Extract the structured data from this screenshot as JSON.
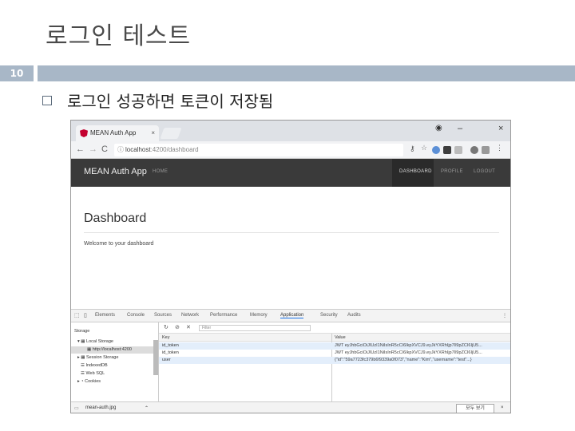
{
  "slide": {
    "title": "로그인 테스트",
    "page_number": "10",
    "bullet": "로그인 성공하면 토큰이 저장됨"
  },
  "browser": {
    "tab_title": "MEAN Auth App",
    "tab_close": "×",
    "url_host": "localhost",
    "url_rest": ":4200/dashboard",
    "back": "←",
    "forward": "→",
    "reload": "C",
    "info_icon": "ⓘ",
    "minimize": "–",
    "close": "×"
  },
  "app": {
    "brand": "MEAN Auth App",
    "nav_home": "HOME",
    "nav_dashboard": "DASHBOARD",
    "nav_profile": "PROFILE",
    "nav_logout": "LOGOUT",
    "dashboard_title": "Dashboard",
    "welcome": "Welcome to your dashboard"
  },
  "devtools": {
    "tabs": [
      "Elements",
      "Console",
      "Sources",
      "Network",
      "Performance",
      "Memory",
      "Application",
      "Security",
      "Audits"
    ],
    "active_tab": "Application",
    "storage_label": "Storage",
    "local_storage": "Local Storage",
    "local_origin": "http://localhost:4200",
    "session_storage": "Session Storage",
    "indexeddb": "IndexedDB",
    "websql": "Web SQL",
    "cookies": "Cookies",
    "filter_placeholder": "Filter",
    "key_header": "Key",
    "value_header": "Value",
    "rows": [
      {
        "key": "id_token",
        "value": "JWT eyJhbGciOiJIUzI1NiIsInR5cCI6IkpXVCJ9.eyJkYXRhIjp7Il9pZCI6IjU5..."
      },
      {
        "key": "id_token",
        "value": "JWT eyJhbGciOiJIUzI1NiIsInR5cCI6IkpXVCJ9.eyJkYXRhIjp7Il9pZCI6IjU5..."
      },
      {
        "key": "user",
        "value": "{\"id\":\"59a7723fc379b6f9339a0f073\",\"name\":\"Kim\",\"username\":\"test\"...}"
      }
    ]
  },
  "download": {
    "file": "mean-auth.jpg",
    "button": "모두 보기"
  },
  "colors": {
    "accent_bar": "#a8b7c7",
    "app_nav": "#3a3a3a"
  }
}
